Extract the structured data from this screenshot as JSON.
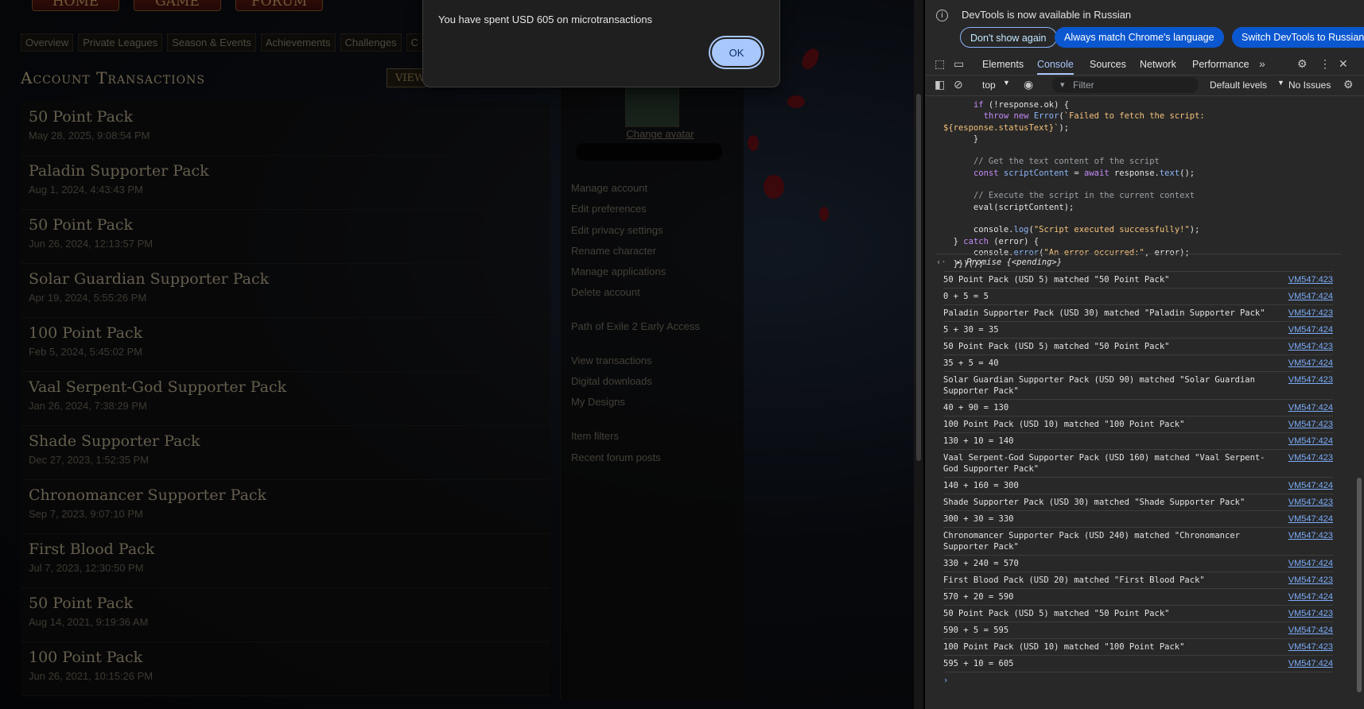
{
  "page": {
    "top_nav": [
      "HOME",
      "GAME",
      "FORUM"
    ],
    "sub_tabs": [
      "Overview",
      "Private Leagues",
      "Season & Events",
      "Achievements",
      "Challenges",
      "C"
    ],
    "title": "Account Transactions",
    "view_button": "VIEW",
    "transactions": [
      {
        "name": "50 Point Pack",
        "date": "May 28, 2025, 9:08:54 PM"
      },
      {
        "name": "Paladin Supporter Pack",
        "date": "Aug 1, 2024, 4:43:43 PM"
      },
      {
        "name": "50 Point Pack",
        "date": "Jun 26, 2024, 12:13:57 PM"
      },
      {
        "name": "Solar Guardian Supporter Pack",
        "date": "Apr 19, 2024, 5:55:26 PM"
      },
      {
        "name": "100 Point Pack",
        "date": "Feb 5, 2024, 5:45:02 PM"
      },
      {
        "name": "Vaal Serpent-God Supporter Pack",
        "date": "Jan 26, 2024, 7:38:29 PM"
      },
      {
        "name": "Shade Supporter Pack",
        "date": "Dec 27, 2023, 1:52:35 PM"
      },
      {
        "name": "Chronomancer Supporter Pack",
        "date": "Sep 7, 2023, 9:07:10 PM"
      },
      {
        "name": "First Blood Pack",
        "date": "Jul 7, 2023, 12:30:50 PM"
      },
      {
        "name": "50 Point Pack",
        "date": "Aug 14, 2021, 9:19:36 AM"
      },
      {
        "name": "100 Point Pack",
        "date": "Jun 26, 2021, 10:15:26 PM"
      }
    ],
    "change_avatar": "Change avatar",
    "account_menu": [
      "Manage account",
      "Edit preferences",
      "Edit privacy settings",
      "Rename character",
      "Manage applications",
      "Delete account",
      "Path of Exile 2 Early Access",
      "View transactions",
      "Digital downloads",
      "My Designs",
      "Item filters",
      "Recent forum posts"
    ]
  },
  "dialog": {
    "message": "You have spent USD 605 on microtransactions",
    "ok_label": "OK"
  },
  "devtools": {
    "info_text": "DevTools is now available in Russian",
    "btn_dont_show": "Don't show again",
    "btn_always_match": "Always match Chrome's language",
    "btn_switch": "Switch DevTools to Russian",
    "tabs": [
      "Elements",
      "Console",
      "Sources",
      "Network",
      "Performance"
    ],
    "active_tab": "Console",
    "context": "top",
    "filter_placeholder": "Filter",
    "levels": "Default levels",
    "issues": "No Issues",
    "promise": "Promise {<pending>}",
    "logs": [
      {
        "text": "50 Point Pack (USD 5) matched \"50 Point Pack\"",
        "src": "VM547:423"
      },
      {
        "text": "0 + 5 = 5",
        "src": "VM547:424"
      },
      {
        "text": "Paladin Supporter Pack (USD 30) matched \"Paladin Supporter Pack\"",
        "src": "VM547:423"
      },
      {
        "text": "5 + 30 = 35",
        "src": "VM547:424"
      },
      {
        "text": "50 Point Pack (USD 5) matched \"50 Point Pack\"",
        "src": "VM547:423"
      },
      {
        "text": "35 + 5 = 40",
        "src": "VM547:424"
      },
      {
        "text": "Solar Guardian Supporter Pack (USD 90) matched \"Solar Guardian Supporter Pack\"",
        "src": "VM547:423"
      },
      {
        "text": "40 + 90 = 130",
        "src": "VM547:424"
      },
      {
        "text": "100 Point Pack (USD 10) matched \"100 Point Pack\"",
        "src": "VM547:423"
      },
      {
        "text": "130 + 10 = 140",
        "src": "VM547:424"
      },
      {
        "text": "Vaal Serpent-God Supporter Pack (USD 160) matched \"Vaal Serpent-God Supporter Pack\"",
        "src": "VM547:423"
      },
      {
        "text": "140 + 160 = 300",
        "src": "VM547:424"
      },
      {
        "text": "Shade Supporter Pack (USD 30) matched \"Shade Supporter Pack\"",
        "src": "VM547:423"
      },
      {
        "text": "300 + 30 = 330",
        "src": "VM547:424"
      },
      {
        "text": "Chronomancer Supporter Pack (USD 240) matched \"Chronomancer Supporter Pack\"",
        "src": "VM547:423"
      },
      {
        "text": "330 + 240 = 570",
        "src": "VM547:424"
      },
      {
        "text": "First Blood Pack (USD 20) matched \"First Blood Pack\"",
        "src": "VM547:423"
      },
      {
        "text": "570 + 20 = 590",
        "src": "VM547:424"
      },
      {
        "text": "50 Point Pack (USD 5) matched \"50 Point Pack\"",
        "src": "VM547:423"
      },
      {
        "text": "590 + 5 = 595",
        "src": "VM547:424"
      },
      {
        "text": "100 Point Pack (USD 10) matched \"100 Point Pack\"",
        "src": "VM547:423"
      },
      {
        "text": "595 + 10 = 605",
        "src": "VM547:424"
      }
    ]
  }
}
